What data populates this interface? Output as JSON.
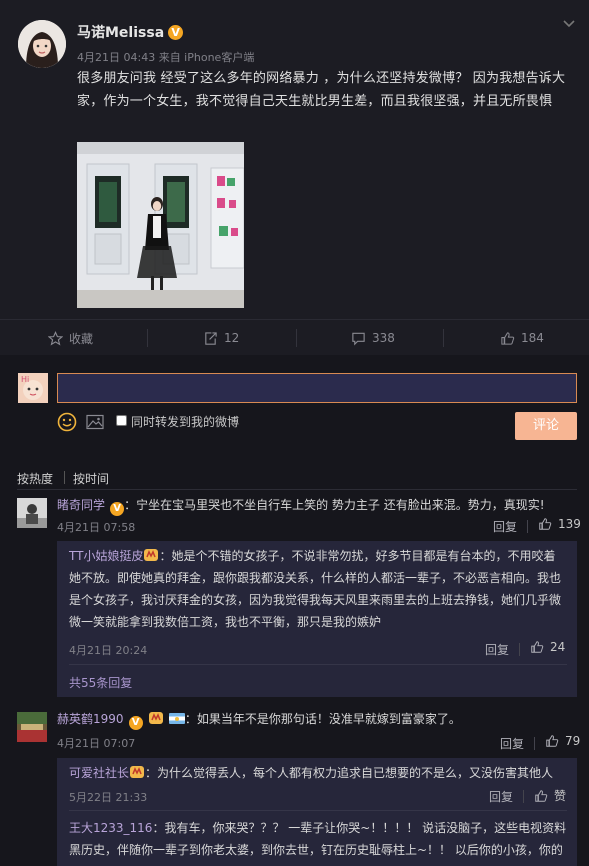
{
  "post": {
    "author": "马诺Melissa",
    "verified": "V",
    "meta": "4月21日 04:43 来自 iPhone客户端",
    "text": "很多朋友问我 经受了这么多年的网络暴力 ，为什么还坚持发微博？ 因为我想告诉大家，作为一个女生，我不觉得自己天生就比男生差，而且我很坚强，并且无所畏惧",
    "actions": {
      "favorite": "收藏",
      "repost": "12",
      "comment": "338",
      "like": "184"
    }
  },
  "composer": {
    "placeholder": "",
    "repost_checkbox_label": "同时转发到我的微博",
    "submit": "评论"
  },
  "sort": {
    "hot": "按热度",
    "time": "按时间"
  },
  "comments": [
    {
      "name": "睹奇同学",
      "badge": "V",
      "text": "：宁坐在宝马里哭也不坐自行车上笑的 势力主子 还有脸出来混。势力，真现实!",
      "time": "4月21日 07:58",
      "reply": "回复",
      "likes": "139",
      "replies": [
        {
          "name": "TT小姑娘挺皮",
          "text": "：她是个不错的女孩子，不说非常勿扰，好多节目都是有台本的，不用咬着她不放。即使她真的拜金，跟你跟我都没关系，什么样的人都活一辈子，不必恶言相向。我也是个女孩子，我讨厌拜金的女孩，因为我觉得我每天风里来雨里去的上班去挣钱，她们几乎微微一笑就能拿到我数倍工资，我也不平衡，那只是我的嫉妒",
          "time": "4月21日 20:24",
          "reply": "回复",
          "likes": "24"
        }
      ],
      "more": "共55条回复"
    },
    {
      "name": "赫英鹤1990",
      "badge": "V",
      "text": "：如果当年不是你那句话！没准早就嫁到富豪家了。",
      "time": "4月21日 07:07",
      "reply": "回复",
      "likes": "79",
      "replies": [
        {
          "name": "可爱社社长",
          "text": "：为什么觉得丢人，每个人都有权力追求自已想要的不是么，又没伤害其他人",
          "time": "5月22日 21:33",
          "reply": "回复",
          "likes": "赞"
        },
        {
          "name": "王大1233_116",
          "text": "：我有车，你来哭？？？ 一辈子让你哭~！！！！ 说话没脑子，这些电视资料黑历史，伴随你一辈子到你老太婆，到你去世，钉在历史耻辱柱上~！！ 以后你的小孩，你的"
        }
      ]
    }
  ],
  "colors": {
    "background": "#16161c",
    "post_bg": "#1c1c23",
    "accent": "#f7b593",
    "username": "#b8a4d8",
    "thread_bg": "#26263a"
  }
}
